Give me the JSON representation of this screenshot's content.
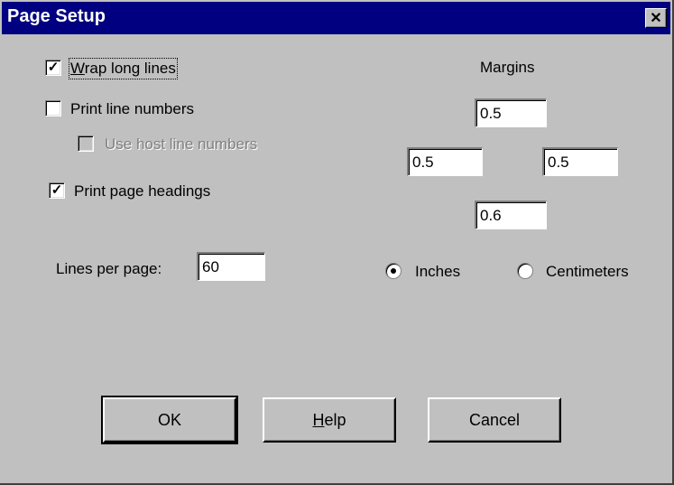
{
  "dialog": {
    "title": "Page Setup"
  },
  "options": {
    "wrap_long_lines": {
      "label_first": "W",
      "label_rest": "rap long lines",
      "checked": true
    },
    "print_line_numbers": {
      "label": "Print line numbers",
      "checked": false
    },
    "use_host_line_numbers": {
      "label": "Use host line numbers",
      "checked": false,
      "enabled": false
    },
    "print_page_headings": {
      "label": "Print page headings",
      "checked": true
    }
  },
  "lines_per_page": {
    "label": "Lines per page:",
    "value": "60"
  },
  "margins": {
    "label": "Margins",
    "top": "0.5",
    "left": "0.5",
    "right": "0.5",
    "bottom": "0.6"
  },
  "units": {
    "inches": {
      "label": "Inches",
      "selected": true
    },
    "centimeters": {
      "label": "Centimeters",
      "selected": false
    }
  },
  "buttons": {
    "ok": "OK",
    "help_first": "H",
    "help_rest": "elp",
    "cancel": "Cancel"
  },
  "icons": {
    "close": "close-icon",
    "check": "checkmark-icon"
  }
}
